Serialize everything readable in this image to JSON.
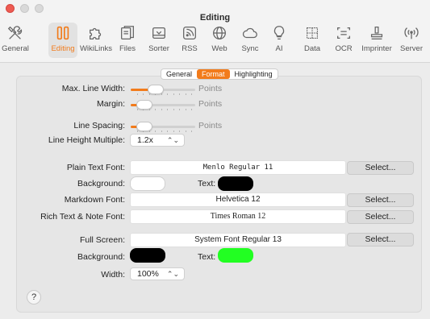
{
  "window": {
    "title": "Editing"
  },
  "toolbar": {
    "items": [
      {
        "label": "General",
        "icon": "tools-icon"
      },
      {
        "label": "Editing",
        "icon": "editing-icon",
        "active": true
      },
      {
        "label": "WikiLinks",
        "icon": "puzzle-icon"
      },
      {
        "label": "Files",
        "icon": "files-icon"
      },
      {
        "label": "Sorter",
        "icon": "sorter-icon"
      },
      {
        "label": "RSS",
        "icon": "rss-icon"
      },
      {
        "label": "Web",
        "icon": "globe-icon"
      },
      {
        "label": "Sync",
        "icon": "cloud-icon"
      },
      {
        "label": "AI",
        "icon": "lightbulb-icon"
      },
      {
        "label": "Data",
        "icon": "table-icon"
      },
      {
        "label": "OCR",
        "icon": "ocr-icon"
      },
      {
        "label": "Imprinter",
        "icon": "stamp-icon"
      },
      {
        "label": "Server",
        "icon": "broadcast-icon"
      }
    ],
    "accent": "#f27b1b"
  },
  "tabs": {
    "items": [
      "General",
      "Format",
      "Highlighting"
    ],
    "selected": "Format"
  },
  "format": {
    "max_line_width": {
      "label": "Max. Line Width:",
      "unit": "Points",
      "level": 0.35
    },
    "margin": {
      "label": "Margin:",
      "unit": "Points",
      "level": 0.12
    },
    "line_spacing": {
      "label": "Line Spacing:",
      "unit": "Points",
      "level": 0.12
    },
    "line_height_multiple": {
      "label": "Line Height Multiple:",
      "value": "1.2x"
    },
    "plain_text_font": {
      "label": "Plain Text Font:",
      "value": "Menlo Regular 11",
      "button": "Select..."
    },
    "plain_background": {
      "label": "Background:",
      "color": "#ffffff"
    },
    "plain_text_color": {
      "label": "Text:",
      "color": "#000000"
    },
    "markdown_font": {
      "label": "Markdown Font:",
      "value": "Helvetica 12",
      "button": "Select..."
    },
    "rich_text_font": {
      "label": "Rich Text & Note Font:",
      "value": "Times Roman 12",
      "button": "Select..."
    },
    "full_screen": {
      "label": "Full Screen:",
      "value": "System Font Regular 13",
      "button": "Select..."
    },
    "fs_background": {
      "label": "Background:",
      "color": "#000000"
    },
    "fs_text_color": {
      "label": "Text:",
      "color": "#22ff22"
    },
    "width": {
      "label": "Width:",
      "value": "100%"
    }
  },
  "help": {
    "label": "?"
  }
}
